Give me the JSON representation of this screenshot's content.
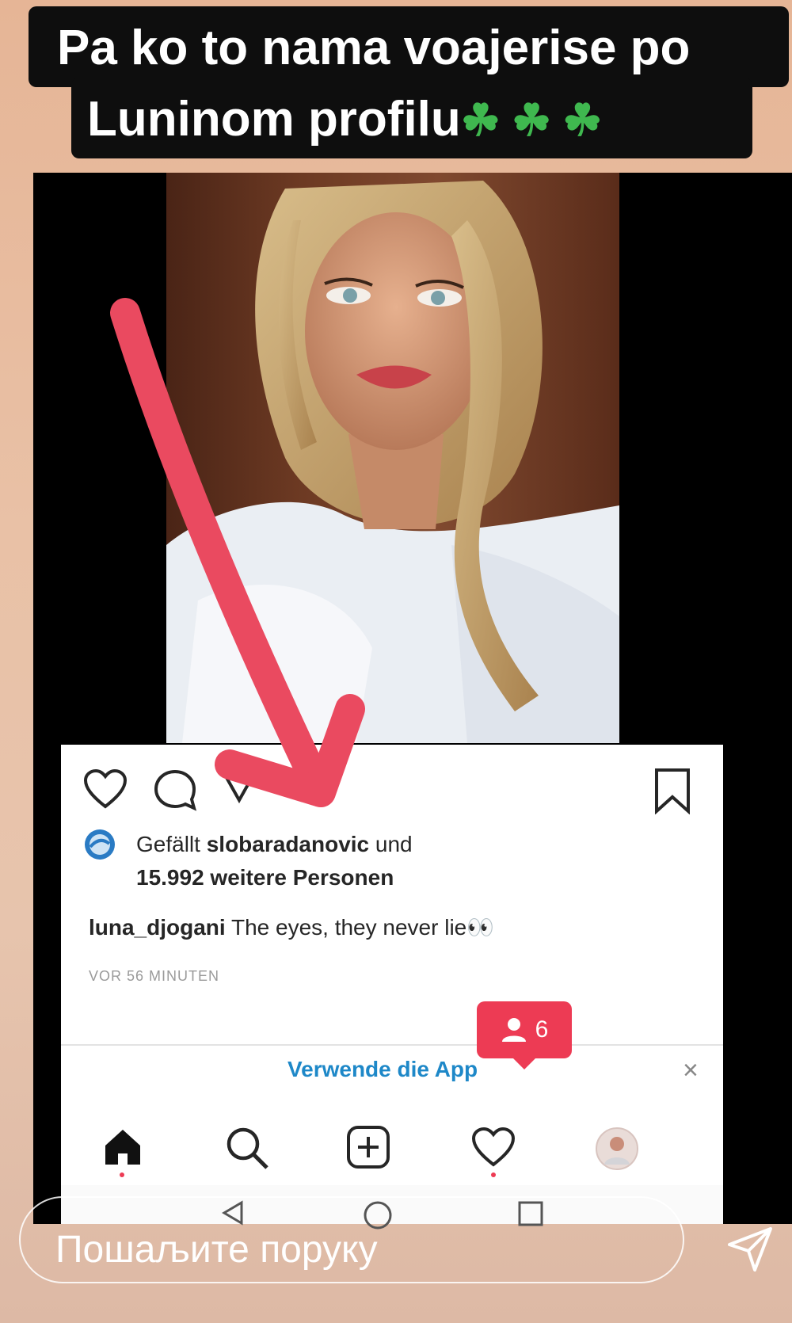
{
  "story_caption": {
    "line1": "Pa ko to nama voajerise po",
    "line2": "Luninom profilu",
    "emojis": "☘☘☘"
  },
  "post": {
    "likes_prefix": "Gefällt",
    "liked_by": "slobaradanovic",
    "likes_and": "und",
    "likes_count": "15.992 weitere Personen",
    "author": "luna_djogani",
    "caption": "The eyes, they never lie",
    "caption_emoji": "👀",
    "timestamp": "VOR 56 MINUTEN"
  },
  "app_banner": {
    "label": "Verwende die App",
    "close": "×"
  },
  "notification": {
    "count": "6"
  },
  "message_input": {
    "placeholder": "Пошаљите поруку"
  },
  "colors": {
    "accent_red": "#ed3b54",
    "arrow": "#ea4a60",
    "clover": "#3fb84f",
    "link_blue": "#1e88c8"
  },
  "icons": [
    "heart-icon",
    "comment-icon",
    "share-icon",
    "bookmark-icon",
    "home-icon",
    "search-icon",
    "add-post-icon",
    "activity-heart-icon",
    "profile-avatar",
    "back-icon",
    "home-circle-icon",
    "recents-icon",
    "send-icon",
    "clover-icon",
    "user-icon"
  ]
}
